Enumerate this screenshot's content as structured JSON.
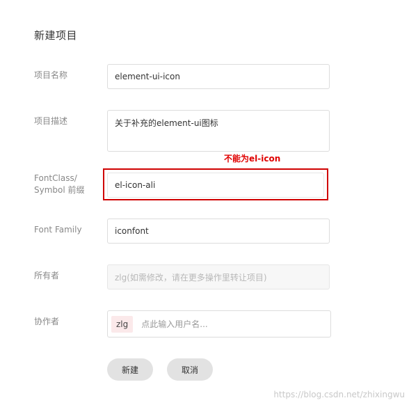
{
  "page": {
    "title": "新建项目"
  },
  "fields": {
    "project_name": {
      "label": "项目名称",
      "value": "element-ui-icon"
    },
    "project_description": {
      "label": "项目描述",
      "value": "关于补充的element-ui图标"
    },
    "font_class_prefix": {
      "label_line1": "FontClass/",
      "label_line2": "Symbol 前缀",
      "value": "el-icon-ali",
      "annotation": "不能为el-icon"
    },
    "font_family": {
      "label": "Font Family",
      "value": "iconfont"
    },
    "owner": {
      "label": "所有者",
      "value": "zlg(如需修改，请在更多操作里转让项目)"
    },
    "collaborators": {
      "label": "协作者",
      "tags": [
        "zlg"
      ],
      "placeholder": "点此输入用户名..."
    }
  },
  "actions": {
    "create_label": "新建",
    "cancel_label": "取消"
  },
  "watermark": "https://blog.csdn.net/zhixingwu",
  "colors": {
    "highlight": "#d00000",
    "annotation": "#e00000",
    "tag_background": "#fbe9ea",
    "button_background": "#e2e2e2"
  }
}
